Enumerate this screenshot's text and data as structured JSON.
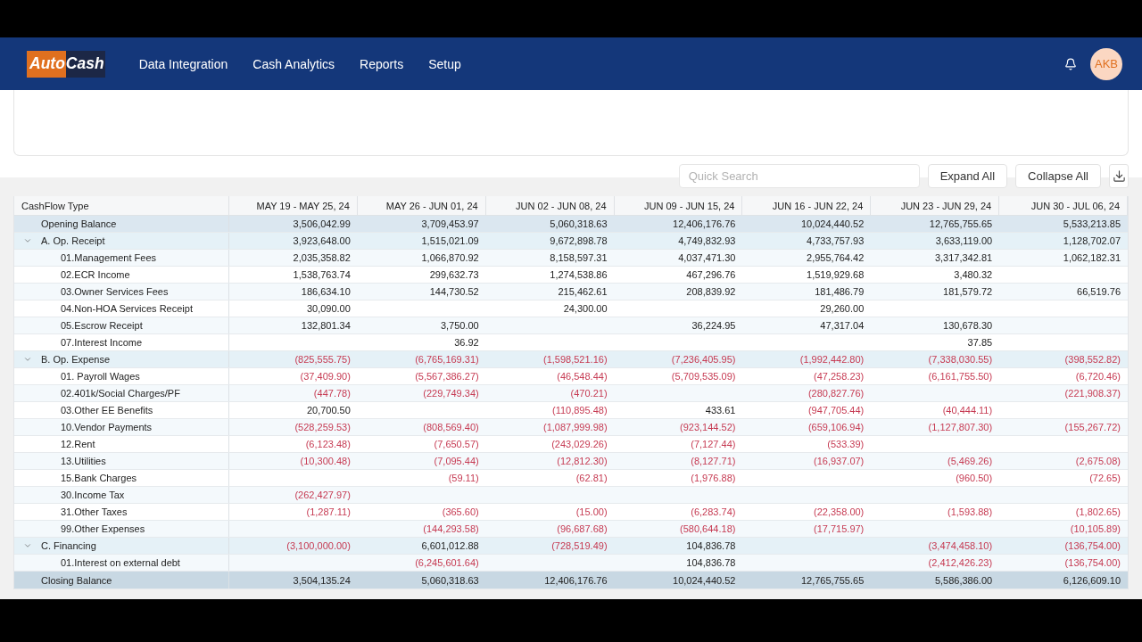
{
  "header": {
    "logo": [
      {
        "text": "Auto",
        "kind": "accent"
      },
      {
        "text": "Cash",
        "kind": "dark"
      }
    ],
    "nav": [
      "Data Integration",
      "Cash Analytics",
      "Reports",
      "Setup"
    ],
    "user": {
      "initials": "AKB"
    }
  },
  "toolbar": {
    "search": {
      "placeholder": "Quick Search"
    },
    "buttons": [
      "Expand All",
      "Collapse All"
    ]
  },
  "table": {
    "columns": [
      "CashFlow Type",
      "MAY 19 - MAY 25, 24",
      "MAY 26 - JUN 01, 24",
      "JUN 02 - JUN 08, 24",
      "JUN 09 - JUN 15, 24",
      "JUN 16 - JUN 22, 24",
      "JUN 23 - JUN 29, 24",
      "JUN 30 - JUL 06, 24"
    ],
    "rows": [
      {
        "kind": "opening",
        "label": "Opening Balance",
        "values": [
          {
            "kind": "amount",
            "value": "3,506,042.99",
            "negative": false
          },
          {
            "kind": "amount",
            "value": "3,709,453.97",
            "negative": false
          },
          {
            "kind": "amount",
            "value": "5,060,318.63",
            "negative": false
          },
          {
            "kind": "amount",
            "value": "12,406,176.76",
            "negative": false
          },
          {
            "kind": "amount",
            "value": "10,024,440.52",
            "negative": false
          },
          {
            "kind": "amount",
            "value": "12,765,755.65",
            "negative": false
          },
          {
            "kind": "amount",
            "value": "5,533,213.85",
            "negative": false
          }
        ]
      },
      {
        "kind": "group",
        "label": "A. Op. Receipt",
        "expanded": true,
        "values": [
          {
            "kind": "amount",
            "value": "3,923,648.00",
            "negative": false
          },
          {
            "kind": "amount",
            "value": "1,515,021.09",
            "negative": false
          },
          {
            "kind": "amount",
            "value": "9,672,898.78",
            "negative": false
          },
          {
            "kind": "amount",
            "value": "4,749,832.93",
            "negative": false
          },
          {
            "kind": "amount",
            "value": "4,733,757.93",
            "negative": false
          },
          {
            "kind": "amount",
            "value": "3,633,119.00",
            "negative": false
          },
          {
            "kind": "amount",
            "value": "1,128,702.07",
            "negative": false
          }
        ],
        "children": [
          {
            "label": "01.Management Fees",
            "values": [
              {
                "kind": "amount",
                "value": "2,035,358.82",
                "negative": false
              },
              {
                "kind": "amount",
                "value": "1,066,870.92",
                "negative": false
              },
              {
                "kind": "amount",
                "value": "8,158,597.31",
                "negative": false
              },
              {
                "kind": "amount",
                "value": "4,037,471.30",
                "negative": false
              },
              {
                "kind": "amount",
                "value": "2,955,764.42",
                "negative": false
              },
              {
                "kind": "amount",
                "value": "3,317,342.81",
                "negative": false
              },
              {
                "kind": "amount",
                "value": "1,062,182.31",
                "negative": false
              }
            ]
          },
          {
            "label": "02.ECR Income",
            "values": [
              {
                "kind": "amount",
                "value": "1,538,763.74",
                "negative": false
              },
              {
                "kind": "amount",
                "value": "299,632.73",
                "negative": false
              },
              {
                "kind": "amount",
                "value": "1,274,538.86",
                "negative": false
              },
              {
                "kind": "amount",
                "value": "467,296.76",
                "negative": false
              },
              {
                "kind": "amount",
                "value": "1,519,929.68",
                "negative": false
              },
              {
                "kind": "amount",
                "value": "3,480.32",
                "negative": false
              },
              {
                "kind": "blank"
              }
            ]
          },
          {
            "label": "03.Owner Services Fees",
            "values": [
              {
                "kind": "amount",
                "value": "186,634.10",
                "negative": false
              },
              {
                "kind": "amount",
                "value": "144,730.52",
                "negative": false
              },
              {
                "kind": "amount",
                "value": "215,462.61",
                "negative": false
              },
              {
                "kind": "amount",
                "value": "208,839.92",
                "negative": false
              },
              {
                "kind": "amount",
                "value": "181,486.79",
                "negative": false
              },
              {
                "kind": "amount",
                "value": "181,579.72",
                "negative": false
              },
              {
                "kind": "amount",
                "value": "66,519.76",
                "negative": false
              }
            ]
          },
          {
            "label": "04.Non-HOA Services Receipt",
            "values": [
              {
                "kind": "amount",
                "value": "30,090.00",
                "negative": false
              },
              {
                "kind": "blank"
              },
              {
                "kind": "amount",
                "value": "24,300.00",
                "negative": false
              },
              {
                "kind": "blank"
              },
              {
                "kind": "amount",
                "value": "29,260.00",
                "negative": false
              },
              {
                "kind": "blank"
              },
              {
                "kind": "blank"
              }
            ]
          },
          {
            "label": "05.Escrow Receipt",
            "values": [
              {
                "kind": "amount",
                "value": "132,801.34",
                "negative": false
              },
              {
                "kind": "amount",
                "value": "3,750.00",
                "negative": false
              },
              {
                "kind": "blank"
              },
              {
                "kind": "amount",
                "value": "36,224.95",
                "negative": false
              },
              {
                "kind": "amount",
                "value": "47,317.04",
                "negative": false
              },
              {
                "kind": "amount",
                "value": "130,678.30",
                "negative": false
              },
              {
                "kind": "blank"
              }
            ]
          },
          {
            "label": "07.Interest Income",
            "values": [
              {
                "kind": "blank"
              },
              {
                "kind": "amount",
                "value": "36.92",
                "negative": false
              },
              {
                "kind": "blank"
              },
              {
                "kind": "blank"
              },
              {
                "kind": "blank"
              },
              {
                "kind": "amount",
                "value": "37.85",
                "negative": false
              },
              {
                "kind": "blank"
              }
            ]
          }
        ]
      },
      {
        "kind": "group",
        "label": "B. Op. Expense",
        "expanded": true,
        "values": [
          {
            "kind": "amount",
            "value": "(825,555.75)",
            "negative": true
          },
          {
            "kind": "amount",
            "value": "(6,765,169.31)",
            "negative": true
          },
          {
            "kind": "amount",
            "value": "(1,598,521.16)",
            "negative": true
          },
          {
            "kind": "amount",
            "value": "(7,236,405.95)",
            "negative": true
          },
          {
            "kind": "amount",
            "value": "(1,992,442.80)",
            "negative": true
          },
          {
            "kind": "amount",
            "value": "(7,338,030.55)",
            "negative": true
          },
          {
            "kind": "amount",
            "value": "(398,552.82)",
            "negative": true
          }
        ],
        "children": [
          {
            "label": "01. Payroll Wages",
            "values": [
              {
                "kind": "amount",
                "value": "(37,409.90)",
                "negative": true
              },
              {
                "kind": "amount",
                "value": "(5,567,386.27)",
                "negative": true
              },
              {
                "kind": "amount",
                "value": "(46,548.44)",
                "negative": true
              },
              {
                "kind": "amount",
                "value": "(5,709,535.09)",
                "negative": true
              },
              {
                "kind": "amount",
                "value": "(47,258.23)",
                "negative": true
              },
              {
                "kind": "amount",
                "value": "(6,161,755.50)",
                "negative": true
              },
              {
                "kind": "amount",
                "value": "(6,720.46)",
                "negative": true
              }
            ]
          },
          {
            "label": "02.401k/Social Charges/PF",
            "values": [
              {
                "kind": "amount",
                "value": "(447.78)",
                "negative": true
              },
              {
                "kind": "amount",
                "value": "(229,749.34)",
                "negative": true
              },
              {
                "kind": "amount",
                "value": "(470.21)",
                "negative": true
              },
              {
                "kind": "blank"
              },
              {
                "kind": "amount",
                "value": "(280,827.76)",
                "negative": true
              },
              {
                "kind": "blank"
              },
              {
                "kind": "amount",
                "value": "(221,908.37)",
                "negative": true
              }
            ]
          },
          {
            "label": "03.Other EE Benefits",
            "values": [
              {
                "kind": "amount",
                "value": "20,700.50",
                "negative": false
              },
              {
                "kind": "blank"
              },
              {
                "kind": "amount",
                "value": "(110,895.48)",
                "negative": true
              },
              {
                "kind": "amount",
                "value": "433.61",
                "negative": false
              },
              {
                "kind": "amount",
                "value": "(947,705.44)",
                "negative": true
              },
              {
                "kind": "amount",
                "value": "(40,444.11)",
                "negative": true
              },
              {
                "kind": "blank"
              }
            ]
          },
          {
            "label": "10.Vendor Payments",
            "values": [
              {
                "kind": "amount",
                "value": "(528,259.53)",
                "negative": true
              },
              {
                "kind": "amount",
                "value": "(808,569.40)",
                "negative": true
              },
              {
                "kind": "amount",
                "value": "(1,087,999.98)",
                "negative": true
              },
              {
                "kind": "amount",
                "value": "(923,144.52)",
                "negative": true
              },
              {
                "kind": "amount",
                "value": "(659,106.94)",
                "negative": true
              },
              {
                "kind": "amount",
                "value": "(1,127,807.30)",
                "negative": true
              },
              {
                "kind": "amount",
                "value": "(155,267.72)",
                "negative": true
              }
            ]
          },
          {
            "label": "12.Rent",
            "values": [
              {
                "kind": "amount",
                "value": "(6,123.48)",
                "negative": true
              },
              {
                "kind": "amount",
                "value": "(7,650.57)",
                "negative": true
              },
              {
                "kind": "amount",
                "value": "(243,029.26)",
                "negative": true
              },
              {
                "kind": "amount",
                "value": "(7,127.44)",
                "negative": true
              },
              {
                "kind": "amount",
                "value": "(533.39)",
                "negative": true
              },
              {
                "kind": "blank"
              },
              {
                "kind": "blank"
              }
            ]
          },
          {
            "label": "13.Utilities",
            "values": [
              {
                "kind": "amount",
                "value": "(10,300.48)",
                "negative": true
              },
              {
                "kind": "amount",
                "value": "(7,095.44)",
                "negative": true
              },
              {
                "kind": "amount",
                "value": "(12,812.30)",
                "negative": true
              },
              {
                "kind": "amount",
                "value": "(8,127.71)",
                "negative": true
              },
              {
                "kind": "amount",
                "value": "(16,937.07)",
                "negative": true
              },
              {
                "kind": "amount",
                "value": "(5,469.26)",
                "negative": true
              },
              {
                "kind": "amount",
                "value": "(2,675.08)",
                "negative": true
              }
            ]
          },
          {
            "label": "15.Bank Charges",
            "values": [
              {
                "kind": "blank"
              },
              {
                "kind": "amount",
                "value": "(59.11)",
                "negative": true
              },
              {
                "kind": "amount",
                "value": "(62.81)",
                "negative": true
              },
              {
                "kind": "amount",
                "value": "(1,976.88)",
                "negative": true
              },
              {
                "kind": "blank"
              },
              {
                "kind": "amount",
                "value": "(960.50)",
                "negative": true
              },
              {
                "kind": "amount",
                "value": "(72.65)",
                "negative": true
              }
            ]
          },
          {
            "label": "30.Income Tax",
            "values": [
              {
                "kind": "amount",
                "value": "(262,427.97)",
                "negative": true
              },
              {
                "kind": "blank"
              },
              {
                "kind": "blank"
              },
              {
                "kind": "blank"
              },
              {
                "kind": "blank"
              },
              {
                "kind": "blank"
              },
              {
                "kind": "blank"
              }
            ]
          },
          {
            "label": "31.Other Taxes",
            "values": [
              {
                "kind": "amount",
                "value": "(1,287.11)",
                "negative": true
              },
              {
                "kind": "amount",
                "value": "(365.60)",
                "negative": true
              },
              {
                "kind": "amount",
                "value": "(15.00)",
                "negative": true
              },
              {
                "kind": "amount",
                "value": "(6,283.74)",
                "negative": true
              },
              {
                "kind": "amount",
                "value": "(22,358.00)",
                "negative": true
              },
              {
                "kind": "amount",
                "value": "(1,593.88)",
                "negative": true
              },
              {
                "kind": "amount",
                "value": "(1,802.65)",
                "negative": true
              }
            ]
          },
          {
            "label": "99.Other Expenses",
            "values": [
              {
                "kind": "blank"
              },
              {
                "kind": "amount",
                "value": "(144,293.58)",
                "negative": true
              },
              {
                "kind": "amount",
                "value": "(96,687.68)",
                "negative": true
              },
              {
                "kind": "amount",
                "value": "(580,644.18)",
                "negative": true
              },
              {
                "kind": "amount",
                "value": "(17,715.97)",
                "negative": true
              },
              {
                "kind": "blank"
              },
              {
                "kind": "amount",
                "value": "(10,105.89)",
                "negative": true
              }
            ]
          }
        ]
      },
      {
        "kind": "group",
        "label": "C. Financing",
        "expanded": true,
        "values": [
          {
            "kind": "amount",
            "value": "(3,100,000.00)",
            "negative": true
          },
          {
            "kind": "amount",
            "value": "6,601,012.88",
            "negative": false
          },
          {
            "kind": "amount",
            "value": "(728,519.49)",
            "negative": true
          },
          {
            "kind": "amount",
            "value": "104,836.78",
            "negative": false
          },
          {
            "kind": "blank"
          },
          {
            "kind": "amount",
            "value": "(3,474,458.10)",
            "negative": true
          },
          {
            "kind": "amount",
            "value": "(136,754.00)",
            "negative": true
          }
        ],
        "children": [
          {
            "label": "01.Interest on external debt",
            "values": [
              {
                "kind": "blank"
              },
              {
                "kind": "amount",
                "value": "(6,245,601.64)",
                "negative": true
              },
              {
                "kind": "blank"
              },
              {
                "kind": "amount",
                "value": "104,836.78",
                "negative": false
              },
              {
                "kind": "blank"
              },
              {
                "kind": "amount",
                "value": "(2,412,426.23)",
                "negative": true
              },
              {
                "kind": "amount",
                "value": "(136,754.00)",
                "negative": true
              }
            ]
          }
        ]
      },
      {
        "kind": "closing",
        "label": "Closing Balance",
        "values": [
          {
            "kind": "amount",
            "value": "3,504,135.24",
            "negative": false
          },
          {
            "kind": "amount",
            "value": "5,060,318.63",
            "negative": false
          },
          {
            "kind": "amount",
            "value": "12,406,176.76",
            "negative": false
          },
          {
            "kind": "amount",
            "value": "10,024,440.52",
            "negative": false
          },
          {
            "kind": "amount",
            "value": "12,765,755.65",
            "negative": false
          },
          {
            "kind": "amount",
            "value": "5,586,386.00",
            "negative": false
          },
          {
            "kind": "amount",
            "value": "6,126,609.10",
            "negative": false
          }
        ]
      }
    ]
  }
}
